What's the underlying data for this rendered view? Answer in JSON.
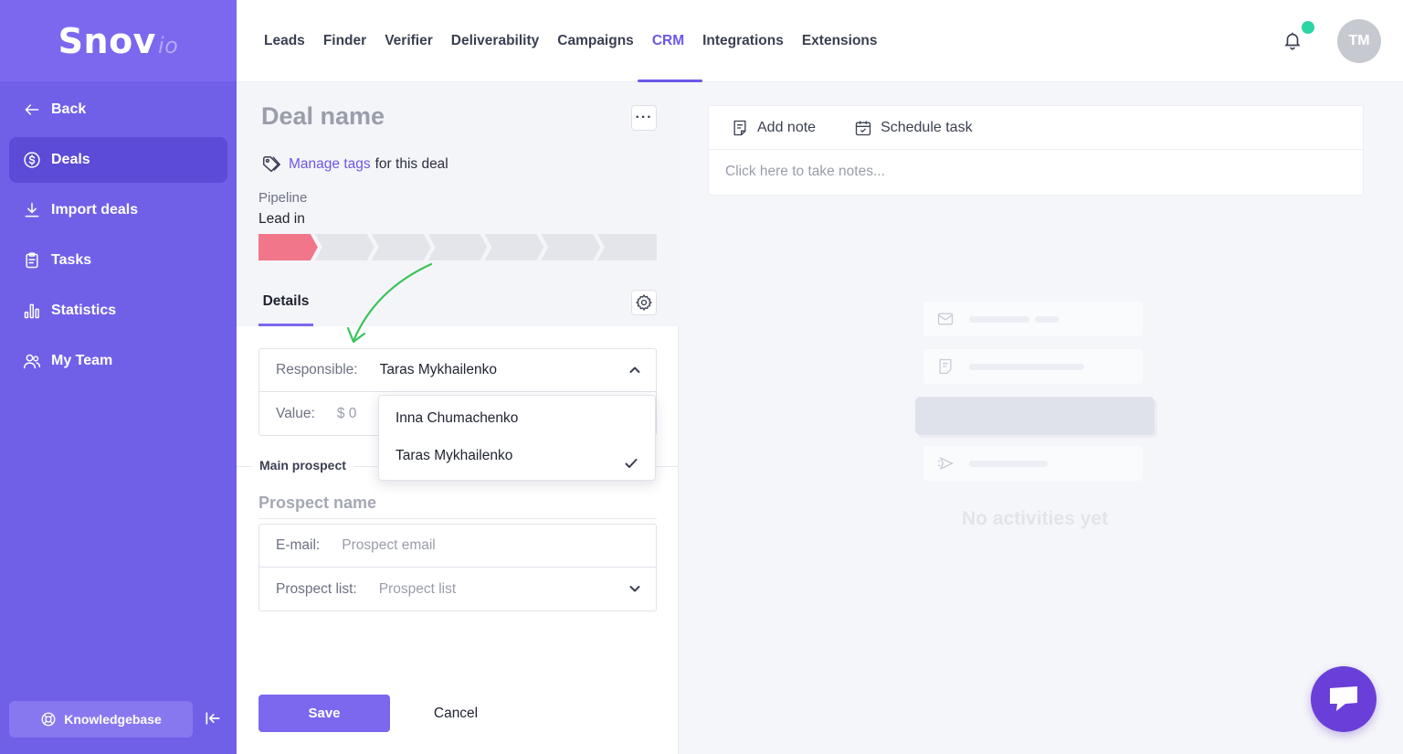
{
  "brand": {
    "name": "Snov",
    "suffix": "io"
  },
  "sidebar": {
    "items": [
      {
        "label": "Back",
        "icon": "arrow-left-icon"
      },
      {
        "label": "Deals",
        "icon": "dollar-circle-icon",
        "active": true
      },
      {
        "label": "Import deals",
        "icon": "download-icon"
      },
      {
        "label": "Tasks",
        "icon": "clipboard-icon"
      },
      {
        "label": "Statistics",
        "icon": "bar-chart-icon"
      },
      {
        "label": "My Team",
        "icon": "team-icon"
      }
    ],
    "knowledgebase_label": "Knowledgebase"
  },
  "topnav": {
    "items": [
      "Leads",
      "Finder",
      "Verifier",
      "Deliverability",
      "Campaigns",
      "CRM",
      "Integrations",
      "Extensions"
    ],
    "active": "CRM",
    "avatar_initials": "TM"
  },
  "deal": {
    "title": "Deal name",
    "tags_link": "Manage tags",
    "tags_suffix": "for this deal",
    "pipeline_label": "Pipeline",
    "pipeline_stage": "Lead in",
    "stages_total": 7,
    "stages_done": 1,
    "details_tab": "Details",
    "responsible_label": "Responsible:",
    "responsible_value": "Taras Mykhailenko",
    "value_label": "Value:",
    "value_value": "$ 0",
    "responsible_options": [
      {
        "name": "Inna Chumachenko",
        "selected": false
      },
      {
        "name": "Taras Mykhailenko",
        "selected": true
      }
    ],
    "main_prospect_label": "Main prospect",
    "prospect_name_placeholder": "Prospect name",
    "email_label": "E-mail:",
    "email_placeholder": "Prospect email",
    "prospect_list_label": "Prospect list:",
    "prospect_list_placeholder": "Prospect list",
    "save_label": "Save",
    "cancel_label": "Cancel"
  },
  "activity": {
    "add_note_label": "Add note",
    "schedule_task_label": "Schedule task",
    "notes_placeholder": "Click here to take notes...",
    "empty_text": "No activities yet"
  },
  "colors": {
    "sidebar": "#7060e8",
    "accent": "#7b68ee",
    "stage_done": "#f2768a",
    "notification_dot": "#2bd6a4",
    "chat_button": "#6a3fd9",
    "annotation_arrow": "#3ac45a"
  }
}
